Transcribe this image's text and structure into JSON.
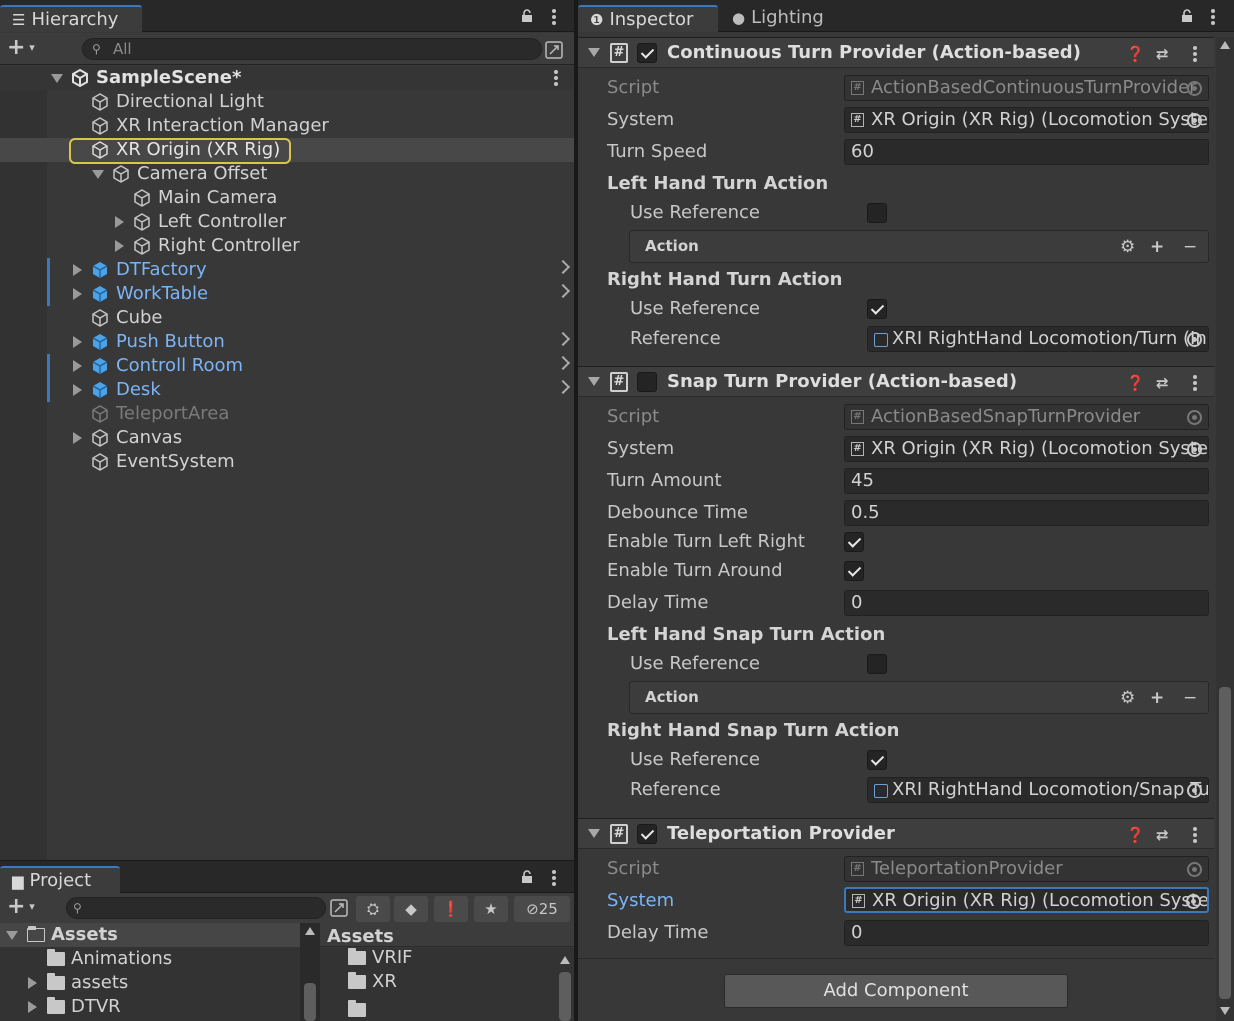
{
  "hierarchy": {
    "tab_label": "Hierarchy",
    "search_placeholder": "All",
    "scene_name": "SampleScene*",
    "items": [
      {
        "label": "Directional Light"
      },
      {
        "label": "XR Interaction Manager"
      },
      {
        "label": "XR Origin (XR Rig)"
      },
      {
        "label": "Camera Offset"
      },
      {
        "label": "Main Camera"
      },
      {
        "label": "Left Controller"
      },
      {
        "label": "Right Controller"
      },
      {
        "label": "DTFactory"
      },
      {
        "label": "WorkTable"
      },
      {
        "label": "Cube"
      },
      {
        "label": "Push Button"
      },
      {
        "label": "Controll Room"
      },
      {
        "label": "Desk"
      },
      {
        "label": "TeleportArea"
      },
      {
        "label": "Canvas"
      },
      {
        "label": "EventSystem"
      }
    ]
  },
  "project": {
    "tab_label": "Project",
    "hidden_count": "25",
    "tree": [
      {
        "label": "Assets"
      },
      {
        "label": "Animations"
      },
      {
        "label": "assets"
      },
      {
        "label": "DTVR"
      }
    ],
    "breadcrumb": "Assets",
    "folders": [
      {
        "label": "VRIF"
      },
      {
        "label": "XR"
      }
    ]
  },
  "inspector": {
    "tab_inspector": "Inspector",
    "tab_lighting": "Lighting",
    "continuous": {
      "title": "Continuous Turn Provider (Action-based)",
      "script_label": "Script",
      "script_value": "ActionBasedContinuousTurnProvider",
      "system_label": "System",
      "system_value": "XR Origin (XR Rig) (Locomotion System)",
      "turn_speed_label": "Turn Speed",
      "turn_speed_value": "60",
      "left_section": "Left Hand Turn Action",
      "use_ref_label": "Use Reference",
      "action_label": "Action",
      "right_section": "Right Hand Turn Action",
      "use_ref_label2": "Use Reference",
      "reference_label": "Reference",
      "reference_value": "XRI RightHand Locomotion/Turn (Input Action Reference)"
    },
    "snap": {
      "title": "Snap Turn Provider (Action-based)",
      "script_label": "Script",
      "script_value": "ActionBasedSnapTurnProvider",
      "system_label": "System",
      "system_value": "XR Origin (XR Rig) (Locomotion System)",
      "turn_amount_label": "Turn Amount",
      "turn_amount_value": "45",
      "debounce_label": "Debounce Time",
      "debounce_value": "0.5",
      "enable_lr_label": "Enable Turn Left Right",
      "enable_around_label": "Enable Turn Around",
      "delay_label": "Delay Time",
      "delay_value": "0",
      "left_section": "Left Hand Snap Turn Action",
      "use_ref_label": "Use Reference",
      "action_label": "Action",
      "right_section": "Right Hand Snap Turn Action",
      "use_ref_label2": "Use Reference",
      "reference_label": "Reference",
      "reference_value": "XRI RightHand Locomotion/Snap Turn (Input Action Reference)"
    },
    "teleport": {
      "title": "Teleportation Provider",
      "script_label": "Script",
      "script_value": "TeleportationProvider",
      "system_label": "System",
      "system_value": "XR Origin (XR Rig) (Locomotion System)",
      "delay_label": "Delay Time",
      "delay_value": "0"
    },
    "add_component": "Add Component"
  }
}
